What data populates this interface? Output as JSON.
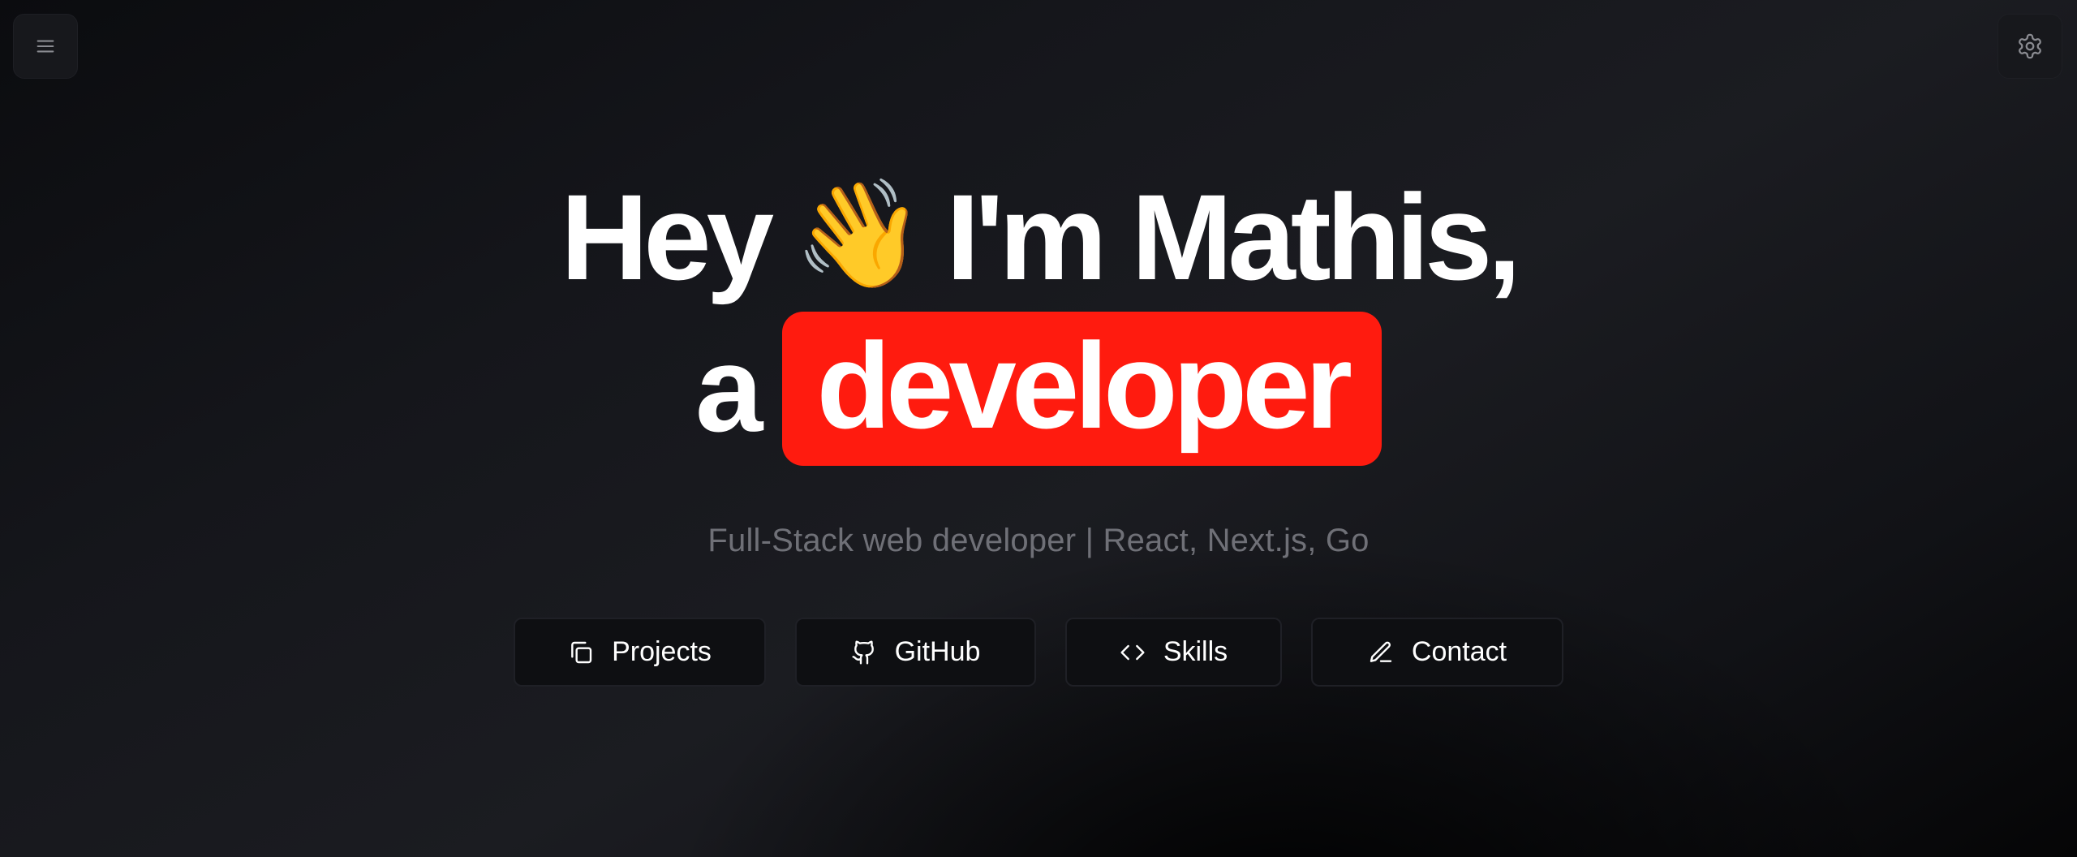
{
  "header": {
    "menu_icon": "hamburger-menu-icon",
    "settings_icon": "gear-icon"
  },
  "hero": {
    "greeting": "Hey",
    "wave_emoji": "👋",
    "intro": "I'm Mathis,",
    "article": "a",
    "role": "developer",
    "subtitle": "Full-Stack web developer | React, Next.js, Go"
  },
  "actions": [
    {
      "label": "Projects",
      "icon": "copy-icon"
    },
    {
      "label": "GitHub",
      "icon": "github-icon"
    },
    {
      "label": "Skills",
      "icon": "code-icon"
    },
    {
      "label": "Contact",
      "icon": "pencil-icon"
    }
  ],
  "colors": {
    "background": "#141519",
    "highlight": "#ff1b0f",
    "text": "#ffffff",
    "subtitle": "#6f7077",
    "button_bg": "#0e0f12",
    "button_border": "#1f2026"
  }
}
